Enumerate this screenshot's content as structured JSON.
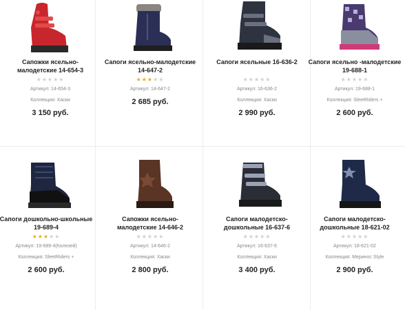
{
  "products": [
    {
      "name": "Сапожки ясельно-малодетские 14-654-3",
      "rating": 0,
      "article": "Артикул: 14-654-3",
      "collection": "Коллекция: Хаски",
      "price": "3 150 руб.",
      "image": "red-boot-image",
      "colors": {
        "main": "#c8262d",
        "sole": "#2a2a2a",
        "accent": "#e04a4a"
      }
    },
    {
      "name": "Сапоги ясельно-малодетские 14-647-2",
      "rating": 3,
      "article": "Артикул: 14-647-2",
      "collection": "",
      "price": "2 685 руб.",
      "image": "navy-fur-boot-image",
      "colors": {
        "main": "#2b2f55",
        "sole": "#1f1f1f",
        "accent": "#8a8580"
      }
    },
    {
      "name": "Сапоги ясельные 16-636-2",
      "rating": 0,
      "article": "Артикул: 16-636-2",
      "collection": "Коллекция: Хаски",
      "price": "2 990 руб.",
      "image": "dark-velcro-boot-image",
      "colors": {
        "main": "#2e3340",
        "sole": "#1a1a1a",
        "accent": "#6b7080"
      }
    },
    {
      "name": "Сапоги ясельно -малодетские 19-688-1",
      "rating": 0,
      "article": "Артикул: 19-688-1",
      "collection": "Коллекция: SleetRiders +",
      "price": "2 600 руб.",
      "image": "purple-pattern-boot-image",
      "colors": {
        "main": "#4a3a70",
        "sole": "#cf3a78",
        "accent": "#b8b0d8"
      }
    },
    {
      "name": "Сапоги дошкольно-школьные 19-689-4",
      "rating": 3,
      "article": "Артикул: 19-689-4(Колезей)",
      "collection": "Коллекция: SleetRiders +",
      "price": "2 600 руб.",
      "image": "navy-black-boot-image",
      "colors": {
        "main": "#1e2640",
        "sole": "#111111",
        "accent": "#3a4a70"
      }
    },
    {
      "name": "Сапожки ясельно-малодетские 14-646-2",
      "rating": 0,
      "article": "Артикул: 14-646-2",
      "collection": "Коллекция: Хаски",
      "price": "2 800 руб.",
      "image": "brown-leather-boot-image",
      "colors": {
        "main": "#5a3424",
        "sole": "#2a1a14",
        "accent": "#7a4a36"
      }
    },
    {
      "name": "Сапоги малодетско-дошкольные 16-637-6",
      "rating": 0,
      "article": "Артикул: 16-637-6",
      "collection": "Коллекция: Хаски",
      "price": "3 400 руб.",
      "image": "grey-velcro-boot-image",
      "colors": {
        "main": "#2a2d36",
        "sole": "#1a1a1a",
        "accent": "#9aa3b5"
      }
    },
    {
      "name": "Сапоги малодетско-дошкольные 18-621-02",
      "rating": 0,
      "article": "Артикул: 18-621-02",
      "collection": "Коллекция: Меринос Style",
      "price": "2 900 руб.",
      "image": "navy-star-boot-image",
      "colors": {
        "main": "#1f2a48",
        "sole": "#151515",
        "accent": "#8090b0"
      }
    }
  ]
}
